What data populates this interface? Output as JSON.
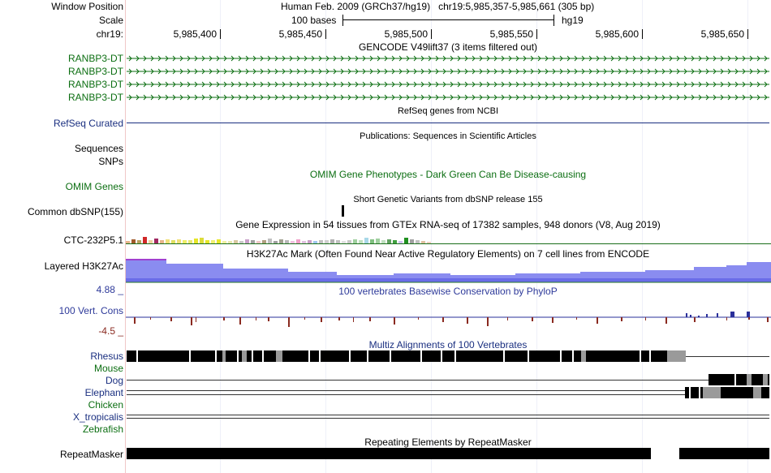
{
  "header": {
    "window_position_label": "Window Position",
    "scale_label": "Scale",
    "chr_label": "chr19:",
    "assembly_title": "Human Feb. 2009 (GRCh37/hg19)",
    "position": "chr19:5,985,357-5,985,661 (305 bp)",
    "scale_text": "100 bases",
    "scale_db": "hg19",
    "ticks": [
      "5,985,400",
      "5,985,450",
      "5,985,500",
      "5,985,550",
      "5,985,600",
      "5,985,650"
    ]
  },
  "tracks": {
    "gencode": {
      "title": "GENCODE V49lift37 (3 items filtered out)",
      "items": [
        "RANBP3-DT",
        "RANBP3-DT",
        "RANBP3-DT",
        "RANBP3-DT"
      ]
    },
    "refseq": {
      "title": "RefSeq genes from NCBI",
      "label": "RefSeq Curated"
    },
    "pubs": {
      "title": "Publications: Sequences in Scientific Articles",
      "labels": [
        "Sequences",
        "SNPs"
      ]
    },
    "omim": {
      "title": "OMIM Gene Phenotypes - Dark Green Can Be Disease-causing",
      "label": "OMIM Genes"
    },
    "dbsnp": {
      "title": "Short Genetic Variants from dbSNP release 155",
      "label": "Common dbSNP(155)"
    },
    "gtex": {
      "title": "Gene Expression in 54 tissues from GTEx RNA-seq of 17382 samples, 948 donors (V8, Aug 2019)",
      "label": "CTC-232P5.1"
    },
    "h3k27ac": {
      "title": "H3K27Ac Mark (Often Found Near Active Regulatory Elements) on 7 cell lines from ENCODE",
      "label": "Layered H3K27Ac"
    },
    "phylop": {
      "title": "100 vertebrates Basewise Conservation by PhyloP",
      "label": "100 Vert. Cons",
      "max": "4.88 _",
      "min": "-4.5 _"
    },
    "multiz": {
      "title": "Multiz Alignments of 100 Vertebrates",
      "species": [
        "Rhesus",
        "Mouse",
        "Dog",
        "Elephant",
        "Chicken",
        "X_tropicalis",
        "Zebrafish"
      ]
    },
    "rmsk": {
      "title": "Repeating Elements by RepeatMasker",
      "label": "RepeatMasker"
    }
  },
  "colors": {
    "gencode_green": "#0b6e11",
    "refseq_navy": "#1a2f80",
    "h3k27ac_fill": "#8a8cf0",
    "phylop_pos": "#2a2f9a",
    "phylop_neg": "#8a2a20"
  }
}
